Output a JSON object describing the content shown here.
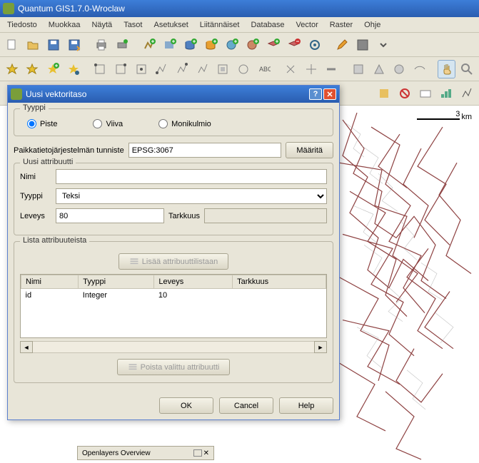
{
  "window": {
    "title": "Quantum GIS1.7.0-Wroclaw"
  },
  "menu": [
    "Tiedosto",
    "Muokkaa",
    "Näytä",
    "Tasot",
    "Asetukset",
    "Liitännäiset",
    "Database",
    "Vector",
    "Raster",
    "Ohje"
  ],
  "scale": {
    "value": "3",
    "unit": "km"
  },
  "dialog": {
    "title": "Uusi vektoritaso",
    "type_group": {
      "legend": "Tyyppi",
      "options": [
        "Piste",
        "Viiva",
        "Monikulmio"
      ],
      "selected": "Piste"
    },
    "crs_label": "Paikkatietojärjestelmän tunniste",
    "crs_value": "EPSG:3067",
    "crs_button": "Määritä",
    "new_attr": {
      "legend": "Uusi attribuutti",
      "name_label": "Nimi",
      "name_value": "",
      "type_label": "Tyyppi",
      "type_value": "Teksi",
      "width_label": "Leveys",
      "width_value": "80",
      "precision_label": "Tarkkuus",
      "precision_value": ""
    },
    "attr_list": {
      "legend": "Lista attribuuteista",
      "add_button": "Lisää attribuuttilistaan",
      "remove_button": "Poista valittu attribuutti",
      "columns": [
        "Nimi",
        "Tyyppi",
        "Leveys",
        "Tarkkuus"
      ],
      "rows": [
        {
          "name": "id",
          "type": "Integer",
          "width": "10",
          "precision": ""
        }
      ]
    },
    "buttons": {
      "ok": "OK",
      "cancel": "Cancel",
      "help": "Help"
    }
  },
  "panel": {
    "label": "Openlayers Overview"
  }
}
